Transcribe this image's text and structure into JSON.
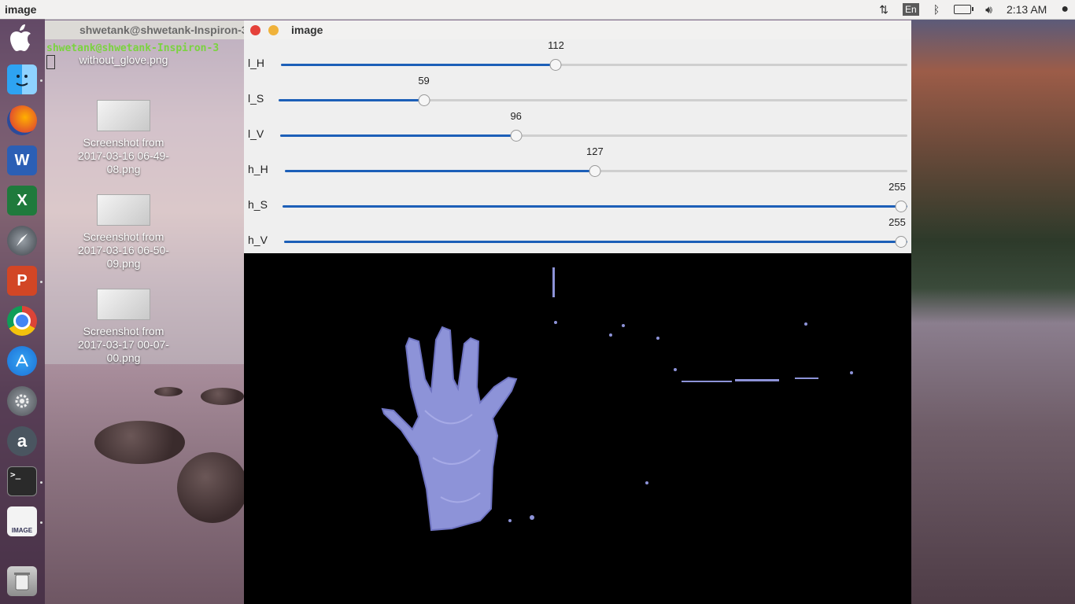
{
  "topbar": {
    "app_title": "image",
    "language": "En",
    "clock": "2:13 AM"
  },
  "dock": {
    "items": [
      {
        "name": "apple-icon"
      },
      {
        "name": "finder-icon"
      },
      {
        "name": "firefox-icon"
      },
      {
        "name": "word-icon",
        "glyph": "W"
      },
      {
        "name": "excel-icon",
        "glyph": "X"
      },
      {
        "name": "launchpad-icon"
      },
      {
        "name": "powerpoint-icon",
        "glyph": "P"
      },
      {
        "name": "chrome-icon"
      },
      {
        "name": "appstore-icon"
      },
      {
        "name": "settings-icon"
      },
      {
        "name": "amazon-icon",
        "glyph": "a"
      },
      {
        "name": "terminal-icon",
        "glyph": ">_"
      },
      {
        "name": "image-viewer-icon",
        "glyph": "IMAGE"
      },
      {
        "name": "trash-icon"
      }
    ]
  },
  "terminal": {
    "title": "shwetank@shwetank-Inspiron-3",
    "prompt": "shwetank@shwetank-Inspiron-3"
  },
  "desktop": {
    "files": [
      {
        "name": "without_glove.png"
      },
      {
        "name": "Screenshot from 2017-03-16 06-49-08.png"
      },
      {
        "name": "Screenshot from 2017-03-16 06-50-09.png"
      },
      {
        "name": "Screenshot from 2017-03-17 00-07-00.png"
      }
    ]
  },
  "image_window": {
    "title": "image",
    "trackbars": [
      {
        "label": "l_H",
        "value": "112",
        "fraction": 0.439
      },
      {
        "label": "l_S",
        "value": "59",
        "fraction": 0.231
      },
      {
        "label": "l_V",
        "value": "96",
        "fraction": 0.376
      },
      {
        "label": "h_H",
        "value": "127",
        "fraction": 0.498
      },
      {
        "label": "h_S",
        "value": "255",
        "fraction": 1.0
      },
      {
        "label": "h_V",
        "value": "255",
        "fraction": 1.0
      }
    ]
  },
  "colors": {
    "slider_fill": "#1c5fb8",
    "mask_foreground": "#8d93d8",
    "close_button": "#e5413a",
    "minimize_button": "#f0b23a"
  }
}
